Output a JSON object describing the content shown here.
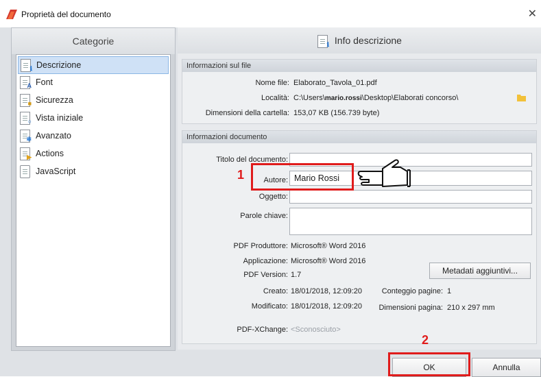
{
  "window": {
    "title": "Proprietà del documento"
  },
  "left_panel": {
    "header": "Categorie",
    "items": [
      {
        "label": "Descrizione",
        "icon": "doc-info-icon",
        "selected": true
      },
      {
        "label": "Font",
        "icon": "doc-font-icon"
      },
      {
        "label": "Sicurezza",
        "icon": "doc-lock-icon"
      },
      {
        "label": "Vista iniziale",
        "icon": "doc-search-icon"
      },
      {
        "label": "Avanzato",
        "icon": "doc-gear-icon"
      },
      {
        "label": "Actions",
        "icon": "doc-arrow-icon"
      },
      {
        "label": "JavaScript",
        "icon": "script-icon"
      }
    ]
  },
  "right_panel": {
    "header": "Info descrizione",
    "file_info": {
      "title": "Informazioni sul file",
      "name_label": "Nome file:",
      "name_value": "Elaborato_Tavola_01.pdf",
      "location_label": "Località:",
      "location_value_pre": "C:\\Users\\",
      "location_value_user": "mario.rossi",
      "location_value_post": "\\Desktop\\Elaborati concorso\\",
      "size_label": "Dimensioni della cartella:",
      "size_value": "153,07 KB (156.739 byte)"
    },
    "doc_info": {
      "title": "Informazioni documento",
      "title_label": "Titolo del documento:",
      "title_value": "",
      "author_label": "Autore:",
      "author_value": "Mario Rossi",
      "subject_label": "Oggetto:",
      "subject_value": "",
      "keywords_label": "Parole chiave:",
      "keywords_value": "",
      "producer_label": "PDF Produttore:",
      "producer_value": "Microsoft® Word 2016",
      "app_label": "Applicazione:",
      "app_value": "Microsoft® Word 2016",
      "version_label": "PDF Version:",
      "version_value": "1.7",
      "metadata_button": "Metadati aggiuntivi...",
      "created_label": "Creato:",
      "created_value": "18/01/2018, 12:09:20",
      "pages_label": "Conteggio pagine:",
      "pages_value": "1",
      "modified_label": "Modificato:",
      "modified_value": "18/01/2018, 12:09:20",
      "pagesize_label": "Dimensioni pagina:",
      "pagesize_value": "210 x 297 mm",
      "xchange_label": "PDF-XChange:",
      "xchange_value": "<Sconosciuto>"
    }
  },
  "buttons": {
    "ok": "OK",
    "cancel": "Annulla"
  },
  "annotations": {
    "step1": "1",
    "step2": "2",
    "color": "#e01b1b"
  }
}
